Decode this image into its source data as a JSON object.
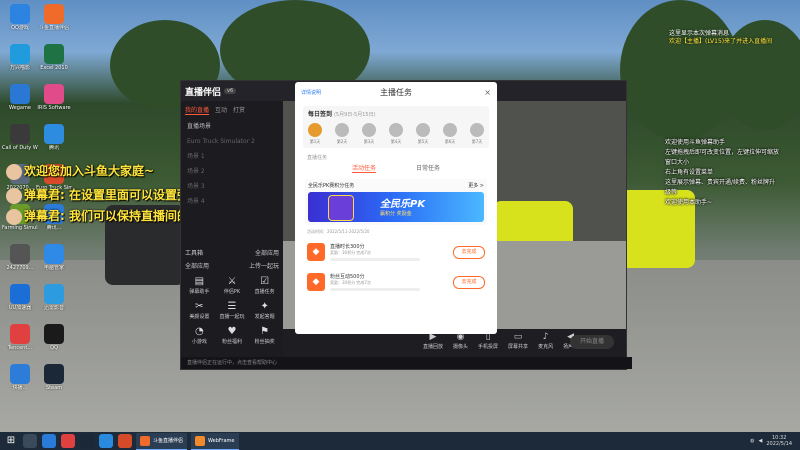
{
  "desktop_icons": [
    {
      "label": "QQ游戏",
      "color": "#2c83e0"
    },
    {
      "label": "斗鱼直播伴侣",
      "color": "#f06a2a"
    },
    {
      "label": "万兴喵影",
      "color": "#1f9bde"
    },
    {
      "label": "Excel 2010",
      "color": "#1f7244"
    },
    {
      "label": "Wegame",
      "color": "#2a78d4"
    },
    {
      "label": "IRIS Software",
      "color": "#e24b8a"
    },
    {
      "label": "Call of Duty WWII - M...",
      "color": "#3a3a3a"
    },
    {
      "label": "腾讯",
      "color": "#2d8ce0"
    },
    {
      "label": "2022070...",
      "color": "#5a6a7a"
    },
    {
      "label": "Euro Truck Simulator 2",
      "color": "#d54b2a"
    },
    {
      "label": "Farming Simulat...",
      "color": "#6a9b2a"
    },
    {
      "label": "腾讯...",
      "color": "#2c7ad8"
    },
    {
      "label": "2427709...",
      "color": "#555"
    },
    {
      "label": "电脑管家",
      "color": "#2e8ae6"
    },
    {
      "label": "UU加速器",
      "color": "#1a6ed6"
    },
    {
      "label": "迅雷影音",
      "color": "#2c9be0"
    },
    {
      "label": "Tencent...",
      "color": "#e04040"
    },
    {
      "label": "QQ",
      "color": "#1a1a1a"
    },
    {
      "label": "快播...",
      "color": "#2c7cd8"
    },
    {
      "label": "Steam",
      "color": "#1b2838"
    }
  ],
  "danmu": [
    "欢迎您加入斗鱼大家庭~",
    "弹幕君: 在设置里面可以设置弹幕样式、筛选展示等~",
    "弹幕君: 我们可以保持直播间的趣味哦(#^.^#)"
  ],
  "app": {
    "logo": "直播伴侣",
    "version": "v6",
    "tabs": [
      "我的直播",
      "互动",
      "打赏"
    ],
    "scenes": [
      "直播场景",
      "Euro Truck Simulator 2",
      "场景 1",
      "场景 2",
      "场景 3",
      "场景 4"
    ],
    "tools_title": "工具箱",
    "tools_more": "全部应用",
    "tools_caption": "全部应用",
    "tools_upload": "上传一起玩",
    "tools": [
      {
        "label": "弹幕助手",
        "icon": "danmu-icon",
        "glyph": "▤"
      },
      {
        "label": "伴侣PK",
        "icon": "pk-icon",
        "glyph": "⚔"
      },
      {
        "label": "直播任务",
        "icon": "task-icon",
        "glyph": "☑"
      },
      {
        "label": "美颜设置",
        "icon": "beauty-icon",
        "glyph": "✂"
      },
      {
        "label": "直播一起玩",
        "icon": "play-icon",
        "glyph": "☰"
      },
      {
        "label": "发起答题",
        "icon": "quiz-icon",
        "glyph": "✦"
      },
      {
        "label": "小游戏",
        "icon": "game-icon",
        "glyph": "◔"
      },
      {
        "label": "粉丝福利",
        "icon": "fans-icon",
        "glyph": "♥"
      },
      {
        "label": "粉丝抽奖",
        "icon": "lottery-icon",
        "glyph": "⚑"
      }
    ],
    "bottom_tools": [
      {
        "label": "直播回放",
        "glyph": "▶"
      },
      {
        "label": "摄像头",
        "glyph": "◉"
      },
      {
        "label": "手机投屏",
        "glyph": "▯"
      },
      {
        "label": "屏幕共享",
        "glyph": "▭"
      },
      {
        "label": "麦克风",
        "glyph": "♪"
      },
      {
        "label": "扬声器",
        "glyph": "◀"
      }
    ],
    "go_live": "开始直播",
    "status": "直播伴侣正在运行中，点击查看帮助中心"
  },
  "modal": {
    "title": "主播任务",
    "link": "详情说明",
    "close": "×",
    "signin_title": "每日签到",
    "signin_period": "(5月9日-5月15日)",
    "days": [
      "第1天",
      "第2天",
      "第3天",
      "第4天",
      "第5天",
      "第6天",
      "第7天"
    ],
    "section_label": "直播任务",
    "task_tabs": [
      "活动任务",
      "日常任务"
    ],
    "promo_title": "全民乐PK赛积分任务",
    "promo_more": "更多 >",
    "banner_title": "全民乐PK",
    "banner_sub": "赢积分 奖励金",
    "period": "活动时间：2022/5/11-2022/5/20",
    "tasks": [
      {
        "name": "直播时长300分",
        "sub": "奖励：30积分 完成7次",
        "button": "去完成",
        "glyph": "◆"
      },
      {
        "name": "粉丝互动500分",
        "sub": "奖励：30积分 完成7次",
        "button": "去完成",
        "glyph": "◆"
      }
    ]
  },
  "chat_top": [
    {
      "text": "这里显示本次弹幕消息",
      "sys": false
    },
    {
      "text": "欢迎【主播】(LV15)来了并进入直播间",
      "sys": true
    }
  ],
  "chat_right": [
    "欢迎使用斗鱼弹幕助手",
    "左键拖拽后即可改变位置，左键拉伸可缩放",
    "窗口大小",
    "右上角有设置菜单",
    "这里展示弹幕、贵宾开通/续费、粉丝牌升",
    "级等",
    "欢迎使用本助手~"
  ],
  "taskbar": {
    "windows": [
      {
        "label": "斗鱼直播伴侣",
        "color": "#f06a2a"
      },
      {
        "label": "WebFrame",
        "color": "#f08a2a"
      }
    ],
    "time": "10:32",
    "date": "2022/5/14"
  }
}
